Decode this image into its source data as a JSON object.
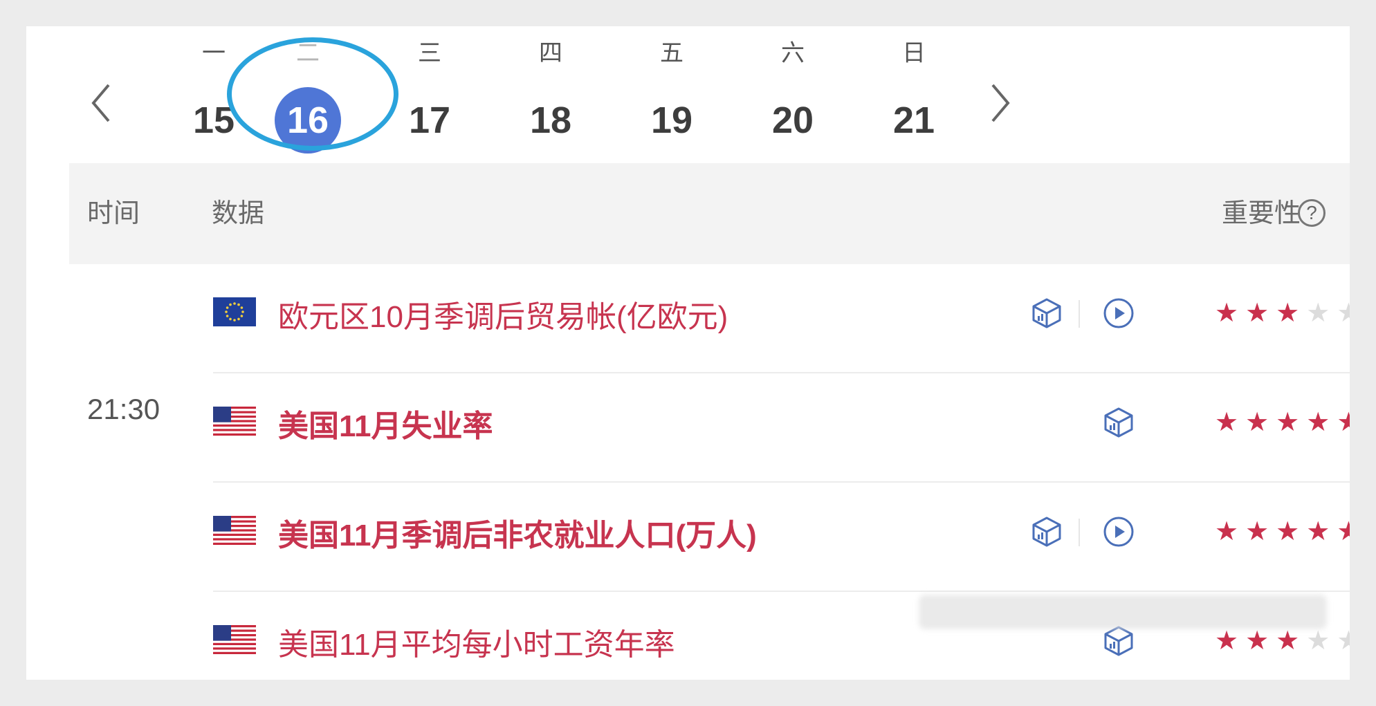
{
  "calendar": {
    "prev_icon": "chevron-left-icon",
    "next_icon": "chevron-right-icon",
    "days": [
      {
        "weekday": "一",
        "date": "15",
        "selected": false
      },
      {
        "weekday": "二",
        "date": "16",
        "selected": true
      },
      {
        "weekday": "三",
        "date": "17",
        "selected": false
      },
      {
        "weekday": "四",
        "date": "18",
        "selected": false
      },
      {
        "weekday": "五",
        "date": "19",
        "selected": false
      },
      {
        "weekday": "六",
        "date": "20",
        "selected": false
      },
      {
        "weekday": "日",
        "date": "21",
        "selected": false
      }
    ]
  },
  "table": {
    "headers": {
      "time": "时间",
      "data": "数据",
      "importance": "重要性",
      "help": "?"
    },
    "time_group": "21:30",
    "rows": [
      {
        "flag": "eu-flag",
        "title": "欧元区10月季调后贸易帐(亿欧元)",
        "bold": false,
        "icons": [
          "cube-chart-icon",
          "play-icon"
        ],
        "stars": 3
      },
      {
        "flag": "us-flag",
        "title": "美国11月失业率",
        "bold": true,
        "icons": [
          "cube-chart-icon"
        ],
        "stars": 5
      },
      {
        "flag": "us-flag",
        "title": "美国11月季调后非农就业人口(万人)",
        "bold": true,
        "icons": [
          "cube-chart-icon",
          "play-icon"
        ],
        "stars": 5
      },
      {
        "flag": "us-flag",
        "title": "美国11月平均每小时工资年率",
        "bold": false,
        "icons": [
          "cube-chart-icon"
        ],
        "stars": 3
      }
    ],
    "max_stars": 5
  },
  "colors": {
    "accent": "#4f76d6",
    "highlight_ring": "#2aa3dc",
    "title_red": "#c7344f",
    "star_on": "#c9314d",
    "star_off": "#dcdcdc"
  }
}
